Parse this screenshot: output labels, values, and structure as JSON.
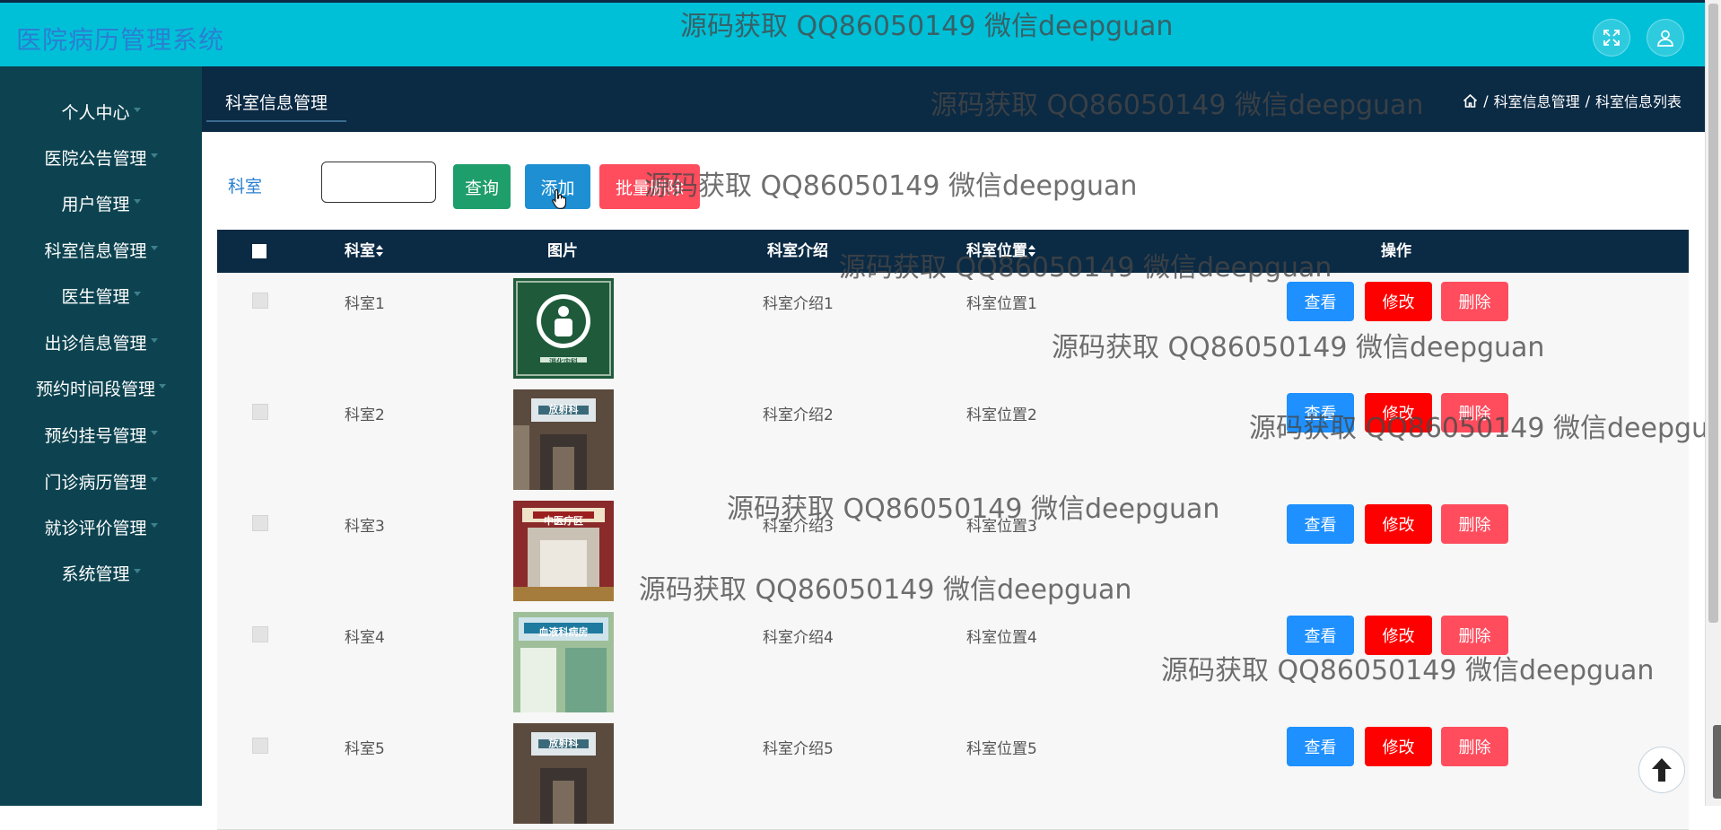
{
  "app": {
    "title": "医院病历管理系统"
  },
  "header": {
    "fullscreen_icon": "fullscreen-icon",
    "user_icon": "user-icon"
  },
  "sidebar": {
    "items": [
      {
        "label": "个人中心"
      },
      {
        "label": "医院公告管理"
      },
      {
        "label": "用户管理"
      },
      {
        "label": "科室信息管理"
      },
      {
        "label": "医生管理"
      },
      {
        "label": "出诊信息管理"
      },
      {
        "label": "预约时间段管理"
      },
      {
        "label": "预约挂号管理"
      },
      {
        "label": "门诊病历管理"
      },
      {
        "label": "就诊评价管理"
      },
      {
        "label": "系统管理"
      }
    ]
  },
  "subnav": {
    "tab": "科室信息管理",
    "breadcrumb": {
      "home_icon": "home-icon",
      "sep": "/",
      "level1": "科室信息管理",
      "level2": "科室信息列表"
    }
  },
  "search": {
    "label": "科室",
    "value": "",
    "query_button": "查询",
    "add_button": "添加",
    "batch_delete_button": "批量删除"
  },
  "table": {
    "headers": {
      "name": "科室",
      "image": "图片",
      "intro": "科室介绍",
      "location": "科室位置",
      "actions": "操作"
    },
    "action_labels": {
      "view": "查看",
      "edit": "修改",
      "delete": "删除"
    },
    "rows": [
      {
        "name": "科室1",
        "intro": "科室介绍1",
        "location": "科室位置1",
        "image_sign": "消化内科"
      },
      {
        "name": "科室2",
        "intro": "科室介绍2",
        "location": "科室位置2",
        "image_sign": "放射科"
      },
      {
        "name": "科室3",
        "intro": "科室介绍3",
        "location": "科室位置3",
        "image_sign": "中医疗区"
      },
      {
        "name": "科室4",
        "intro": "科室介绍4",
        "location": "科室位置4",
        "image_sign": "血液科病房"
      },
      {
        "name": "科室5",
        "intro": "科室介绍5",
        "location": "科室位置5",
        "image_sign": "放射科"
      }
    ]
  },
  "watermark": {
    "text": "源码获取 QQ86050149 微信deepguan"
  },
  "colors": {
    "topbar": "#00c0d8",
    "sidebar": "#0d4350",
    "subnav": "#0b2a44",
    "query": "#1e9e6a",
    "add": "#1d8fd2",
    "batch_delete": "#ff4d5e",
    "view": "#1e90ff",
    "edit": "#ff0000",
    "delete": "#ff4d5e"
  }
}
